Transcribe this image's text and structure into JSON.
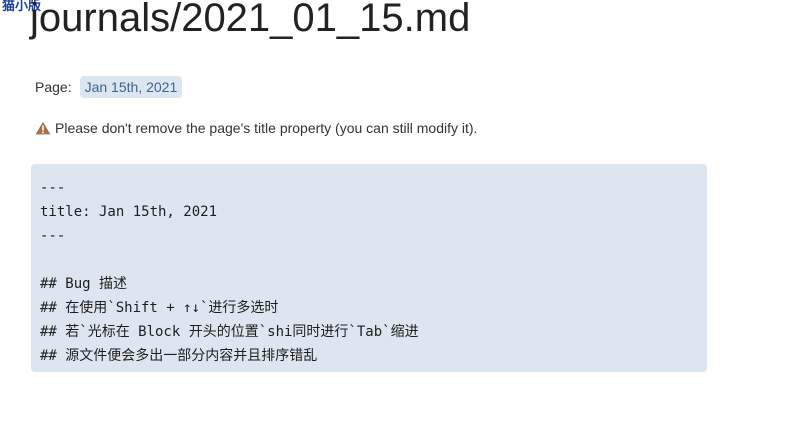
{
  "corner_label": "猫小版",
  "page_title": "journals/2021_01_15.md",
  "properties": {
    "key": "Page:",
    "value": "Jan 15th, 2021"
  },
  "warning": {
    "icon": "warning-triangle",
    "icon_color": "#a5714b",
    "text": "Please don't remove the page's title property (you can still modify it)."
  },
  "code": {
    "background": "#dde6f0",
    "lines": [
      "---",
      "title: Jan 15th, 2021",
      "---",
      "",
      "## Bug 描述",
      "## 在使用`Shift + ↑↓`进行多选时",
      "## 若`光标在 Block 开头的位置`shi同时进行`Tab`缩进",
      "## 源文件便会多出一部分内容并且排序错乱"
    ]
  }
}
